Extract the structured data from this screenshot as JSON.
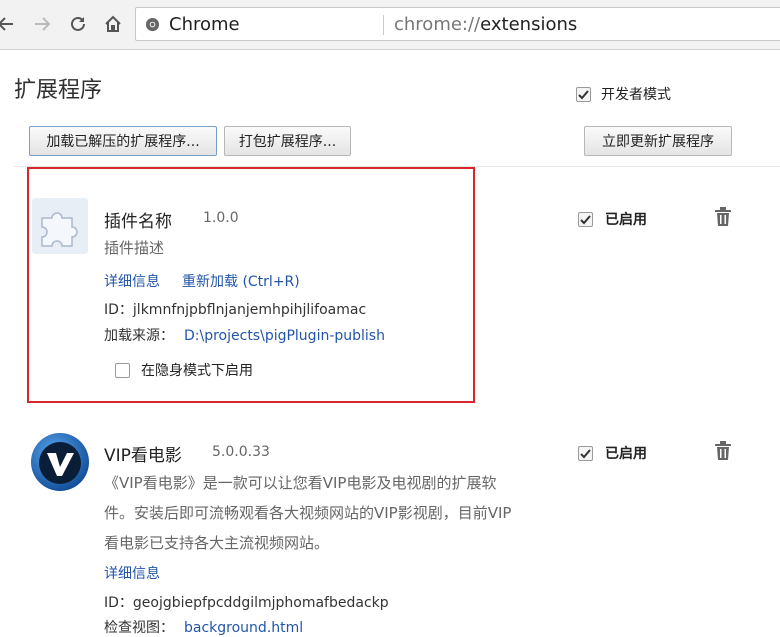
{
  "browser": {
    "site_name": "Chrome",
    "url_scheme": "chrome://",
    "url_rest": "extensions"
  },
  "header": {
    "title": "扩展程序",
    "dev_mode_label": "开发者模式",
    "dev_mode_checked": true
  },
  "toolbar": {
    "load_unpacked": "加载已解压的扩展程序...",
    "pack": "打包扩展程序...",
    "update": "立即更新扩展程序"
  },
  "extensions": [
    {
      "name": "插件名称",
      "version": "1.0.0",
      "description": "插件描述",
      "details_link": "详细信息",
      "reload_link": "重新加载 (Ctrl+R)",
      "id_label": "ID：",
      "id_value": "jlkmnfnjpbflnjanjemhpihjlifoamac",
      "source_label": "加载来源：",
      "source_value": "D:\\projects\\pigPlugin-publish",
      "incognito_label": "在隐身模式下启用",
      "enabled_label": "已启用",
      "icon": "puzzle-icon"
    },
    {
      "name": "VIP看电影",
      "version": "5.0.0.33",
      "description_lines": [
        "《VIP看电影》是一款可以让您看VIP电影及电视剧的扩展软",
        "件。安装后即可流畅观看各大视频网站的VIP影视剧，目前VIP",
        "看电影已支持各大主流视频网站。"
      ],
      "details_link": "详细信息",
      "id_label": "ID：",
      "id_value": "geojgbiepfpcddgilmjphomafbedackp",
      "inspect_label": "检查视图：",
      "inspect_value": "background.html",
      "enabled_label": "已启用",
      "icon": "vip-logo-icon"
    }
  ],
  "colors": {
    "link": "#2255aa",
    "highlight_border": "#d9262c"
  }
}
